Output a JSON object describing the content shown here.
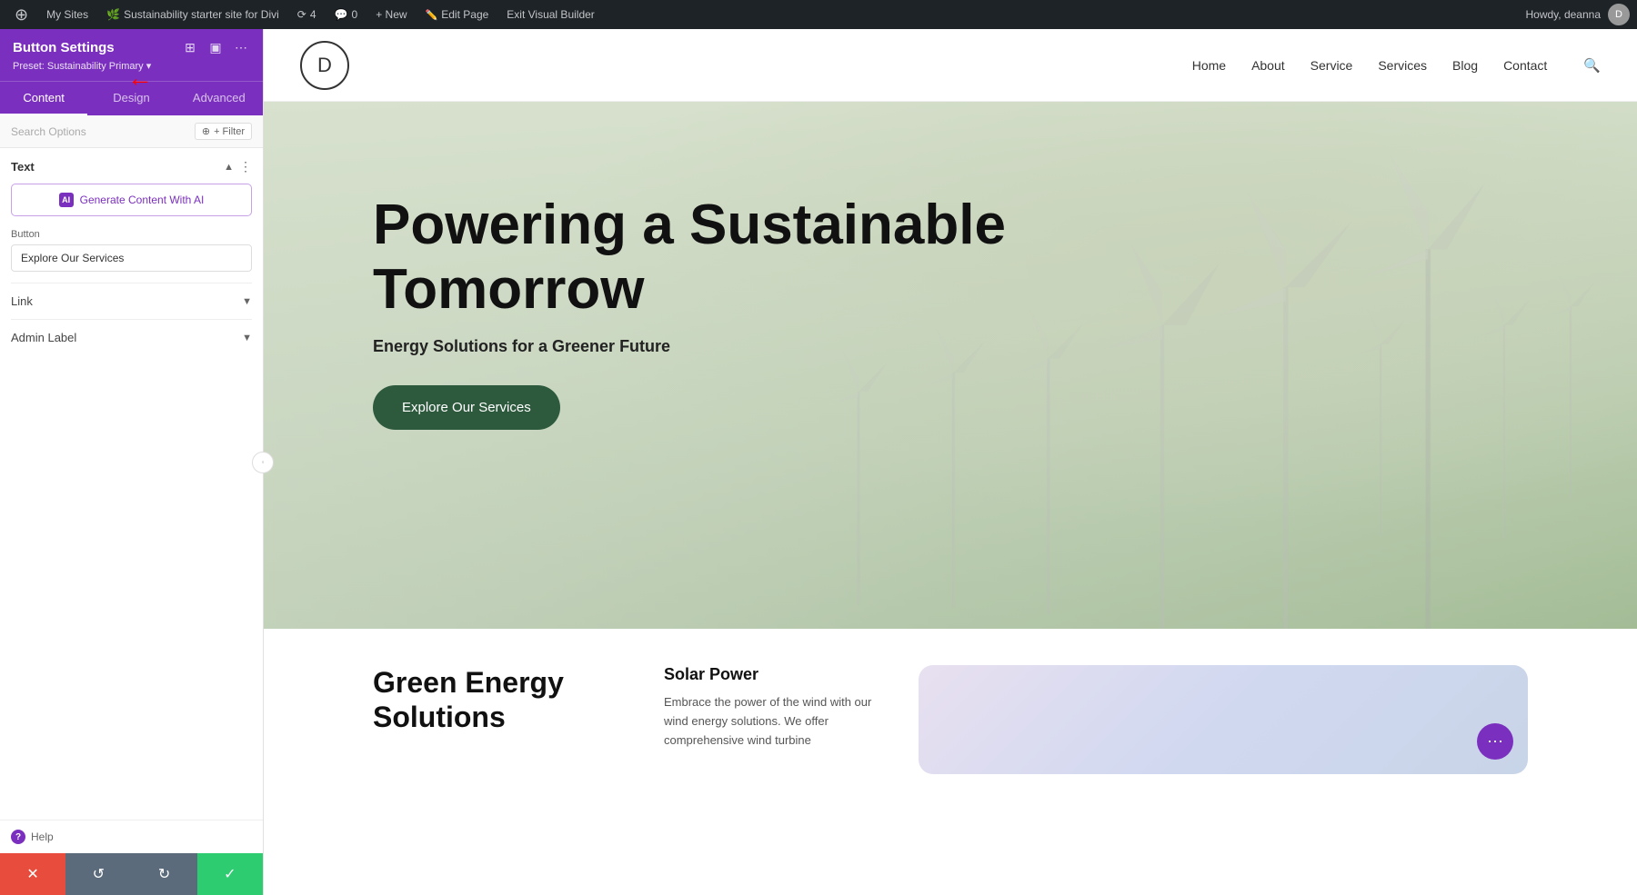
{
  "admin_bar": {
    "wp_icon": "⊕",
    "my_sites_label": "My Sites",
    "site_name": "Sustainability starter site for Divi",
    "notifications_count": "4",
    "comments_count": "0",
    "new_label": "+ New",
    "edit_page_label": "Edit Page",
    "exit_builder_label": "Exit Visual Builder",
    "howdy_label": "Howdy, deanna"
  },
  "panel": {
    "title": "Button Settings",
    "preset_label": "Preset: Sustainability Primary ▾",
    "icons": {
      "responsive": "⊞",
      "toggle": "▣",
      "more": "⋯"
    },
    "tabs": [
      {
        "label": "Content",
        "active": true
      },
      {
        "label": "Design",
        "active": false
      },
      {
        "label": "Advanced",
        "active": false
      }
    ],
    "search_placeholder": "Search Options",
    "filter_label": "+ Filter",
    "text_section": {
      "title": "Text",
      "generate_ai_label": "Generate Content With AI",
      "ai_icon_text": "AI"
    },
    "button_section": {
      "label": "Button",
      "value": "Explore Our Services"
    },
    "link_section": {
      "title": "Link"
    },
    "admin_label_section": {
      "title": "Admin Label"
    },
    "help_label": "Help"
  },
  "bottom_toolbar": {
    "cancel_icon": "✕",
    "undo_icon": "↺",
    "redo_icon": "↻",
    "save_icon": "✓"
  },
  "site_nav": {
    "logo_letter": "D",
    "links": [
      {
        "label": "Home"
      },
      {
        "label": "About"
      },
      {
        "label": "Service"
      },
      {
        "label": "Services"
      },
      {
        "label": "Blog"
      },
      {
        "label": "Contact"
      }
    ],
    "search_icon": "🔍"
  },
  "hero": {
    "title": "Powering a Sustainable Tomorrow",
    "subtitle": "Energy Solutions for a Greener Future",
    "cta_label": "Explore Our Services"
  },
  "below_hero": {
    "green_energy_title": "Green Energy Solutions",
    "solar_power_title": "Solar Power",
    "solar_power_text": "Embrace the power of the wind with our wind energy solutions. We offer comprehensive wind turbine",
    "more_icon": "⋯"
  }
}
